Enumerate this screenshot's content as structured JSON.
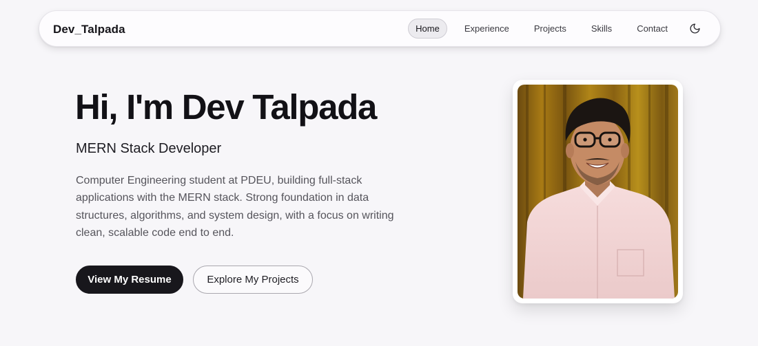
{
  "navbar": {
    "brand": "Dev_Talpada",
    "links": [
      {
        "label": "Home",
        "active": true
      },
      {
        "label": "Experience"
      },
      {
        "label": "Projects"
      },
      {
        "label": "Skills"
      },
      {
        "label": "Contact"
      }
    ],
    "theme_toggle_icon": "moon-icon"
  },
  "hero": {
    "title": "Hi, I'm Dev Talpada",
    "subtitle": "MERN Stack Developer",
    "description": "Computer Engineering student at PDEU, building full-stack applications with the MERN stack. Strong foundation in data structures, algorithms, and system design, with a focus on writing clean, scalable code end to end.",
    "buttons": {
      "primary": "View My Resume",
      "secondary": "Explore My Projects"
    }
  },
  "profile": {
    "photo_icon": "profile-photo"
  },
  "colors": {
    "background": "#f7f6f9",
    "primary_button": "#18171c",
    "text": "#18171c",
    "muted_text": "#55545b"
  }
}
